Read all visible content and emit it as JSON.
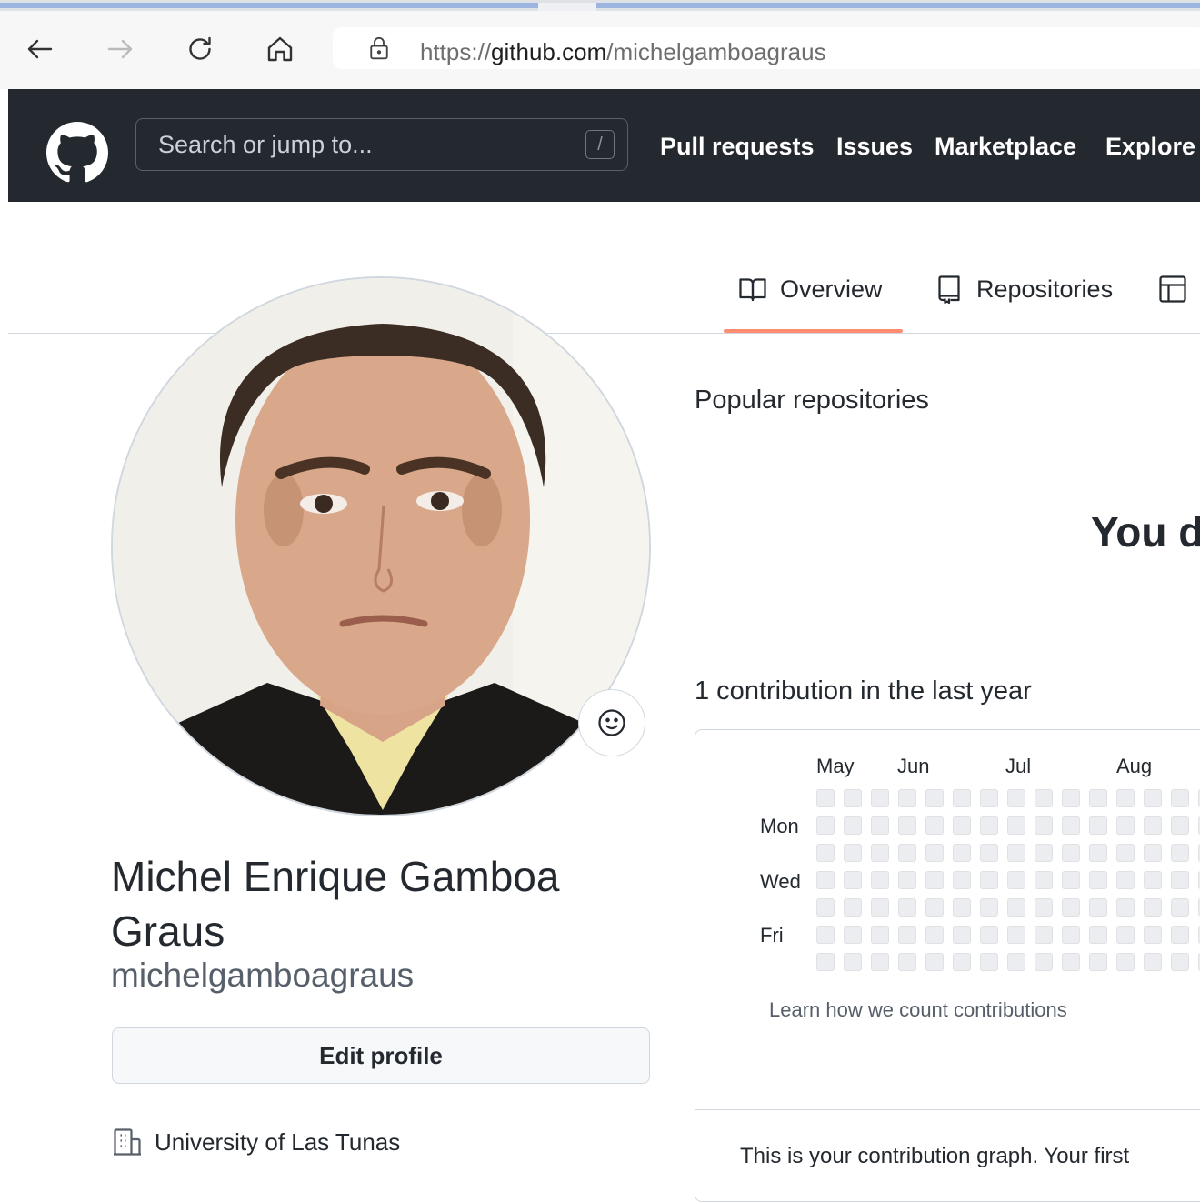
{
  "browser": {
    "url_prefix": "https://",
    "url_host": "github.com",
    "url_path": "/michelgamboagraus",
    "icons": [
      "back-arrow-icon",
      "forward-arrow-icon",
      "reload-icon",
      "home-icon",
      "lock-icon"
    ]
  },
  "header": {
    "search_placeholder": "Search or jump to...",
    "search_shortcut": "/",
    "nav": [
      "Pull requests",
      "Issues",
      "Marketplace",
      "Explore"
    ]
  },
  "tabs": [
    {
      "label": "Overview",
      "icon": "book-icon",
      "selected": true
    },
    {
      "label": "Repositories",
      "icon": "repo-icon",
      "selected": false
    }
  ],
  "profile": {
    "full_name": "Michel Enrique Gamboa Graus",
    "login": "michelgamboagraus",
    "edit_button": "Edit profile",
    "organization": "University of Las Tunas"
  },
  "main": {
    "popular_title": "Popular repositories",
    "blank_heading": "You d",
    "contributions_title": "1 contribution in the last year",
    "months": [
      "May",
      "Jun",
      "Jul",
      "Aug"
    ],
    "days": [
      "Mon",
      "Wed",
      "Fri"
    ],
    "learn_link": "Learn how we count contributions",
    "bottom_text": "This is your contribution graph. Your first"
  },
  "colors": {
    "header_bg": "#24292f",
    "tab_underline": "#fd8c73",
    "empty_cell": "#ebedf0"
  }
}
